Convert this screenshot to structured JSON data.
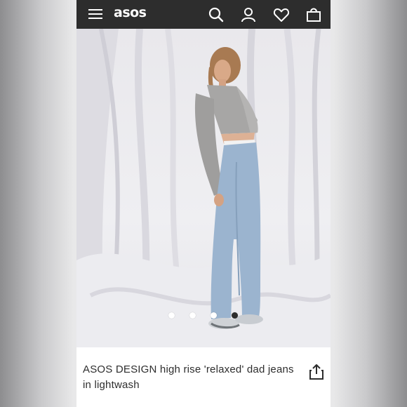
{
  "header": {
    "logo": "asos",
    "icons": [
      "menu-icon",
      "search-icon",
      "account-icon",
      "heart-icon",
      "bag-icon"
    ]
  },
  "gallery": {
    "image_description_icon": "product-photo",
    "dot_count": 4,
    "active_dot": 4
  },
  "product": {
    "title": "ASOS DESIGN high rise 'relaxed' dad jeans in lightwash"
  },
  "colors": {
    "header_bg": "#2d2d2d",
    "text": "#2d2d2d"
  }
}
